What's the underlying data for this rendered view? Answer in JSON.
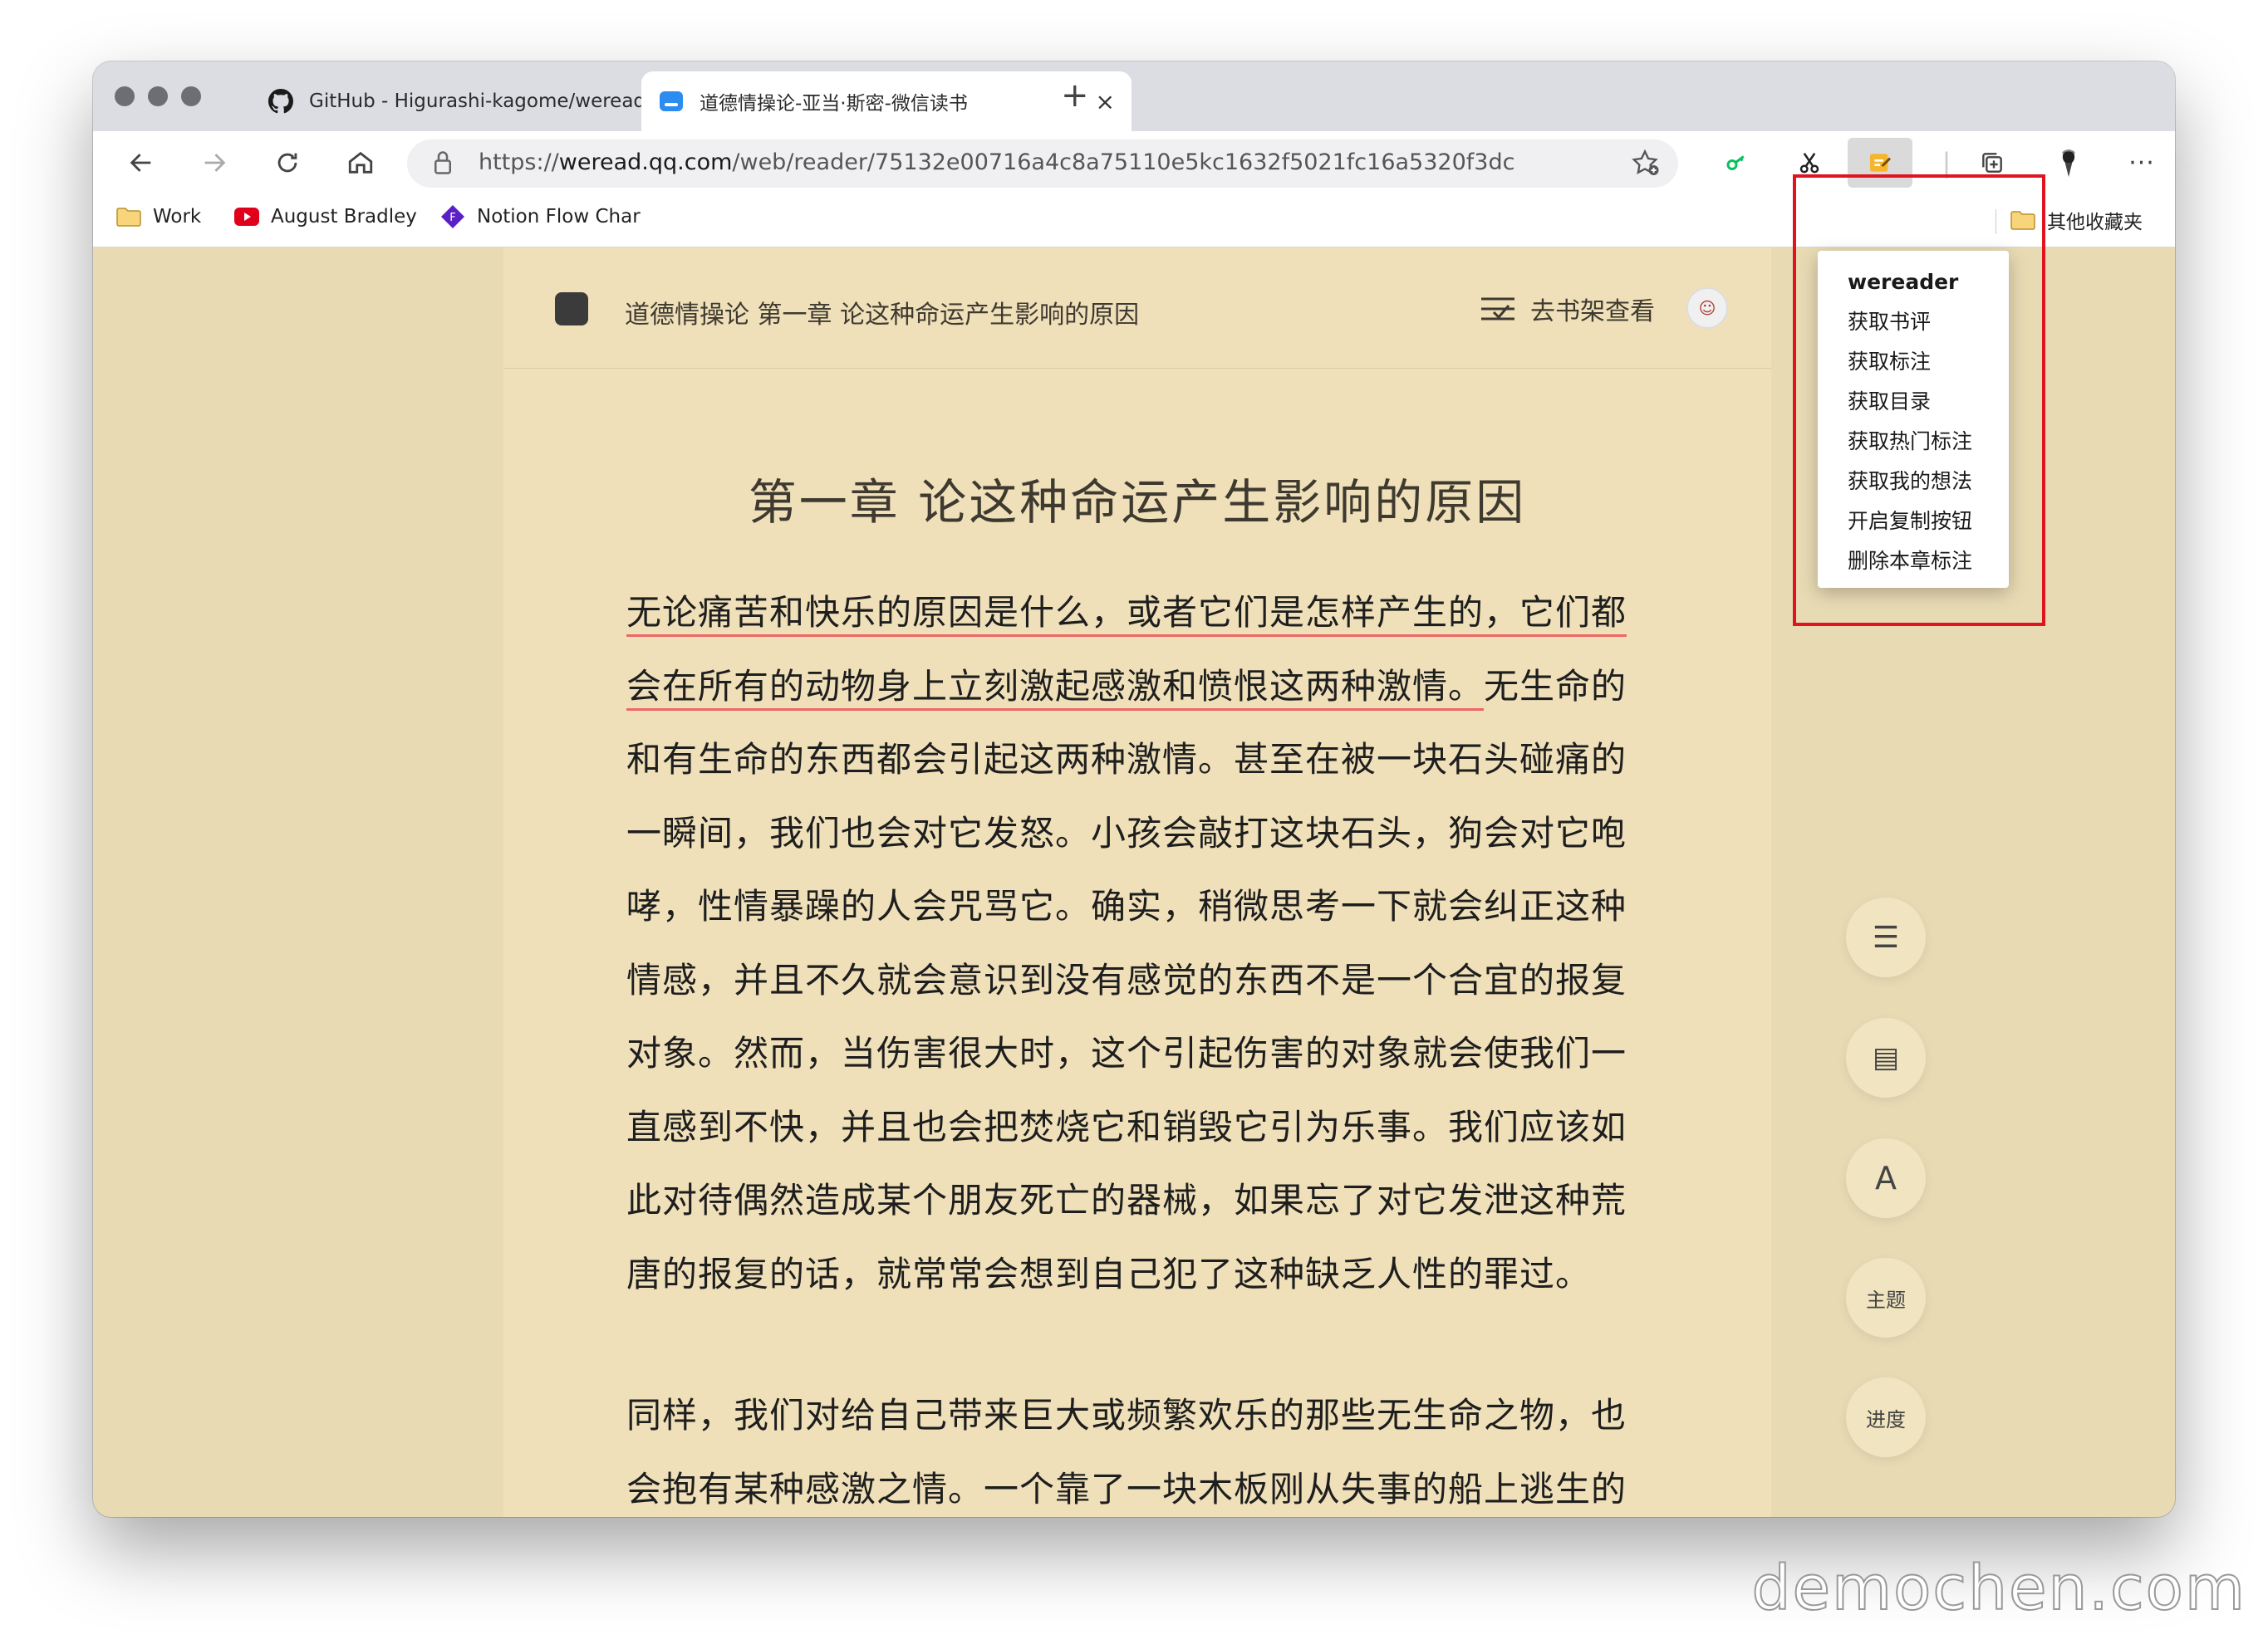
{
  "tabs": [
    {
      "title": "GitHub - Higurashi-kagome/wereader",
      "favicon": "github-icon",
      "close": "×"
    },
    {
      "title": "道德情操论-亚当·斯密-微信读书",
      "favicon": "weread-icon",
      "close": "×"
    }
  ],
  "new_tab": "+",
  "address": {
    "url_prefix": "https://",
    "url_domain": "weread.qq.com",
    "url_path": "/web/reader/75132e00716a4c8a75110e5kc1632f5021fc16a5320f3dc"
  },
  "toolbar": {
    "more": "···"
  },
  "bookmarks": [
    {
      "label": "Work",
      "icon": "folder-icon"
    },
    {
      "label": "August Bradley",
      "icon": "youtube-icon"
    },
    {
      "label": "Notion Flow Char",
      "icon": "notion-flow-icon"
    }
  ],
  "bookmarks_right": {
    "label": "其他收藏夹",
    "icon": "folder-icon"
  },
  "reader": {
    "header_title": "道德情操论 第一章 论这种命运产生影响的原因",
    "shelf_label": "去书架查看",
    "chapter_title": "第一章 论这种命运产生影响的原因",
    "para1_highlight": "无论痛苦和快乐的原因是什么，或者它们是怎样产生的，它们都会在所有的动物身上立刻激起感激和愤恨这两种激情。",
    "para1_rest": "无生命的和有生命的东西都会引起这两种激情。甚至在被一块石头碰痛的一瞬间，我们也会对它发怒。小孩会敲打这块石头，狗会对它咆哮，性情暴躁的人会咒骂它。确实，稍微思考一下就会纠正这种情感，并且不久就会意识到没有感觉的东西不是一个合宜的报复对象。然而，当伤害很大时，这个引起伤害的对象就会使我们一直感到不快，并且也会把焚烧它和销毁它引为乐事。我们应该如此对待偶然造成某个朋友死亡的器械，如果忘了对它发泄这种荒唐的报复的话，就常常会想到自己犯了这种缺乏人性的罪过。",
    "para2": "同样，我们对给自己带来巨大或频繁欢乐的那些无生命之物，也会抱有某种感激之情。一个靠了一块木板刚从失事的船上逃生的"
  },
  "float_buttons": {
    "menu": "☰",
    "notes": "▤",
    "font": "A",
    "theme": "主题",
    "progress": "进度"
  },
  "popup": {
    "header": "wereader",
    "items": [
      "获取书评",
      "获取标注",
      "获取目录",
      "获取热门标注",
      "获取我的想法",
      "开启复制按钮",
      "删除本章标注"
    ]
  },
  "watermark": "demochen.com",
  "colors": {
    "page_bg": "#e8dbb4",
    "reader_bg": "#efe0ba",
    "highlight_underline": "#e66666",
    "annotation_box": "#e0141e"
  }
}
